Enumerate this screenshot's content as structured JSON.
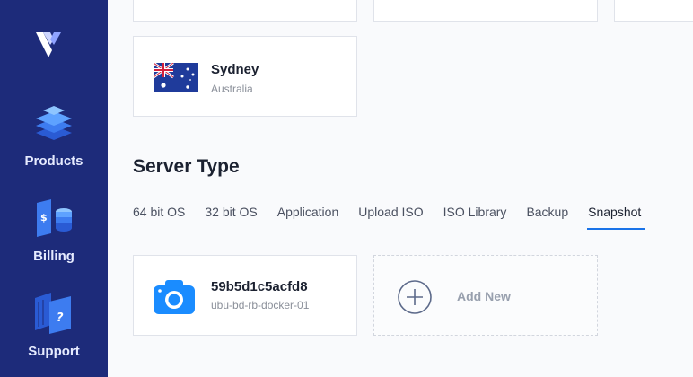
{
  "sidebar": {
    "logo": "vultr-logo-icon",
    "items": [
      {
        "label": "Products",
        "icon": "layers-icon"
      },
      {
        "label": "Billing",
        "icon": "billing-coins-icon"
      },
      {
        "label": "Support",
        "icon": "support-question-icon"
      }
    ]
  },
  "location": {
    "name": "Sydney",
    "country": "Australia",
    "icon": "australia-flag-icon"
  },
  "server_type": {
    "title": "Server Type",
    "tabs": [
      {
        "label": "64 bit OS"
      },
      {
        "label": "32 bit OS"
      },
      {
        "label": "Application"
      },
      {
        "label": "Upload ISO"
      },
      {
        "label": "ISO Library"
      },
      {
        "label": "Backup"
      },
      {
        "label": "Snapshot",
        "active": true
      }
    ]
  },
  "snapshot": {
    "name": "59b5d1c5acfd8",
    "description": "ubu-bd-rb-docker-01",
    "icon": "camera-icon"
  },
  "add_new": {
    "label": "Add New",
    "icon": "plus-circle-icon"
  },
  "colors": {
    "sidebar_bg": "#1d2b7a",
    "accent": "#1a73e8",
    "text_dark": "#1b2130",
    "text_muted": "#8a8f99"
  }
}
